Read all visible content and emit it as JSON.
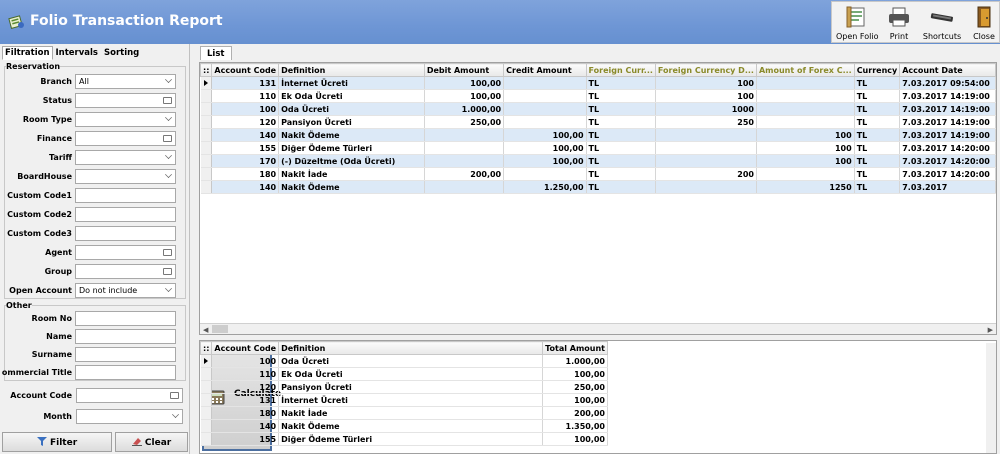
{
  "window": {
    "title": "Folio Transaction Report"
  },
  "toolbar": {
    "open_folio": "Open Folio",
    "print": "Print",
    "shortcuts": "Shortcuts",
    "close": "Close"
  },
  "left_tabs": [
    "Filtration",
    "Intervals",
    "Sorting"
  ],
  "reservation": {
    "title": "Reservation",
    "fields": [
      {
        "label": "Branch",
        "value": "All",
        "kind": "dropdown"
      },
      {
        "label": "Status",
        "value": "",
        "kind": "picker"
      },
      {
        "label": "Room Type",
        "value": "",
        "kind": "dropdown"
      },
      {
        "label": "Finance",
        "value": "",
        "kind": "picker"
      },
      {
        "label": "Tariff",
        "value": "",
        "kind": "dropdown"
      },
      {
        "label": "BoardHouse",
        "value": "",
        "kind": "dropdown"
      },
      {
        "label": "Custom Code1",
        "value": "",
        "kind": "text"
      },
      {
        "label": "Custom Code2",
        "value": "",
        "kind": "text"
      },
      {
        "label": "Custom Code3",
        "value": "",
        "kind": "text"
      },
      {
        "label": "Agent",
        "value": "",
        "kind": "picker"
      },
      {
        "label": "Group",
        "value": "",
        "kind": "picker"
      },
      {
        "label": "Open Account",
        "value": "Do not include",
        "kind": "dropdown"
      }
    ]
  },
  "other": {
    "title": "Other",
    "fields": [
      {
        "label": "Room No",
        "value": ""
      },
      {
        "label": "Name",
        "value": ""
      },
      {
        "label": "Surname",
        "value": ""
      },
      {
        "label": "ommercial Title",
        "value": ""
      }
    ]
  },
  "account_code": {
    "label": "Account Code",
    "value": ""
  },
  "month": {
    "label": "Month",
    "value": ""
  },
  "buttons": {
    "filter": "Filter",
    "clear": "Clear",
    "calculate": "Calculate"
  },
  "right_tab": "List",
  "main_grid": {
    "columns": [
      "Account Code",
      "Definition",
      "Debit Amount",
      "Credit Amount",
      "Foreign Curr...",
      "Foreign Currency D...",
      "Amount of Forex C...",
      "Currency",
      "Account Date"
    ],
    "rows": [
      [
        "131",
        "İnternet Ücreti",
        "100,00",
        "",
        "TL",
        "100",
        "",
        "TL",
        "7.03.2017 09:54:00"
      ],
      [
        "110",
        "Ek Oda Ücreti",
        "100,00",
        "",
        "TL",
        "100",
        "",
        "TL",
        "7.03.2017 14:19:00"
      ],
      [
        "100",
        "Oda Ücreti",
        "1.000,00",
        "",
        "TL",
        "1000",
        "",
        "TL",
        "7.03.2017 14:19:00"
      ],
      [
        "120",
        "Pansiyon Ücreti",
        "250,00",
        "",
        "TL",
        "250",
        "",
        "TL",
        "7.03.2017 14:19:00"
      ],
      [
        "140",
        "Nakit Ödeme",
        "",
        "100,00",
        "TL",
        "",
        "100",
        "TL",
        "7.03.2017 14:19:00"
      ],
      [
        "155",
        "Diğer Ödeme Türleri",
        "",
        "100,00",
        "TL",
        "",
        "100",
        "TL",
        "7.03.2017 14:20:00"
      ],
      [
        "170",
        "(-) Düzeltme (Oda Ücreti)",
        "",
        "100,00",
        "TL",
        "",
        "100",
        "TL",
        "7.03.2017 14:20:00"
      ],
      [
        "180",
        "Nakit İade",
        "200,00",
        "",
        "TL",
        "200",
        "",
        "TL",
        "7.03.2017 14:20:00"
      ],
      [
        "140",
        "Nakit Ödeme",
        "",
        "1.250,00",
        "TL",
        "",
        "1250",
        "TL",
        "7.03.2017"
      ]
    ]
  },
  "summary_grid": {
    "columns": [
      "Account Code",
      "Definition",
      "Total Amount"
    ],
    "rows": [
      [
        "100",
        "Oda Ücreti",
        "1.000,00"
      ],
      [
        "110",
        "Ek Oda Ücreti",
        "100,00"
      ],
      [
        "120",
        "Pansiyon Ücreti",
        "250,00"
      ],
      [
        "131",
        "İnternet Ücreti",
        "100,00"
      ],
      [
        "180",
        "Nakit İade",
        "200,00"
      ],
      [
        "140",
        "Nakit Ödeme",
        "1.350,00"
      ],
      [
        "155",
        "Diğer Ödeme Türleri",
        "100,00"
      ]
    ]
  }
}
